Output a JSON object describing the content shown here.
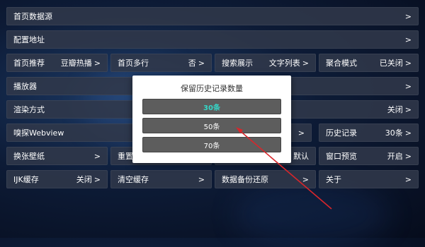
{
  "rows": [
    {
      "label": "首页数据源"
    },
    {
      "label": "配置地址"
    }
  ],
  "row3": [
    {
      "label": "首页推荐",
      "value": "豆瓣热播"
    },
    {
      "label": "首页多行",
      "value": "否"
    },
    {
      "label": "搜索展示",
      "value": "文字列表"
    },
    {
      "label": "聚合模式",
      "value": "已关闭"
    }
  ],
  "player": {
    "label": "播放器"
  },
  "render": {
    "label": "渲染方式",
    "value": "关闭"
  },
  "sniff": {
    "label": "嗅探Webview"
  },
  "history": {
    "label": "历史记录",
    "value": "30条"
  },
  "row7": [
    {
      "label": "换张壁纸"
    },
    {
      "label": "重置"
    },
    {
      "label": "默认"
    },
    {
      "label": "窗口预览",
      "value": "开启"
    }
  ],
  "row8": [
    {
      "label": "IJK缓存",
      "value": "关闭"
    },
    {
      "label": "清空缓存"
    },
    {
      "label": "数据备份还原"
    },
    {
      "label": "关于"
    }
  ],
  "arrow_glyph": ">",
  "dialog": {
    "title": "保留历史记录数量",
    "options": [
      "30条",
      "50条",
      "70条"
    ],
    "selected_index": 0
  },
  "colors": {
    "selected_option": "#35d6c7",
    "annotation_arrow": "#d9262b"
  }
}
